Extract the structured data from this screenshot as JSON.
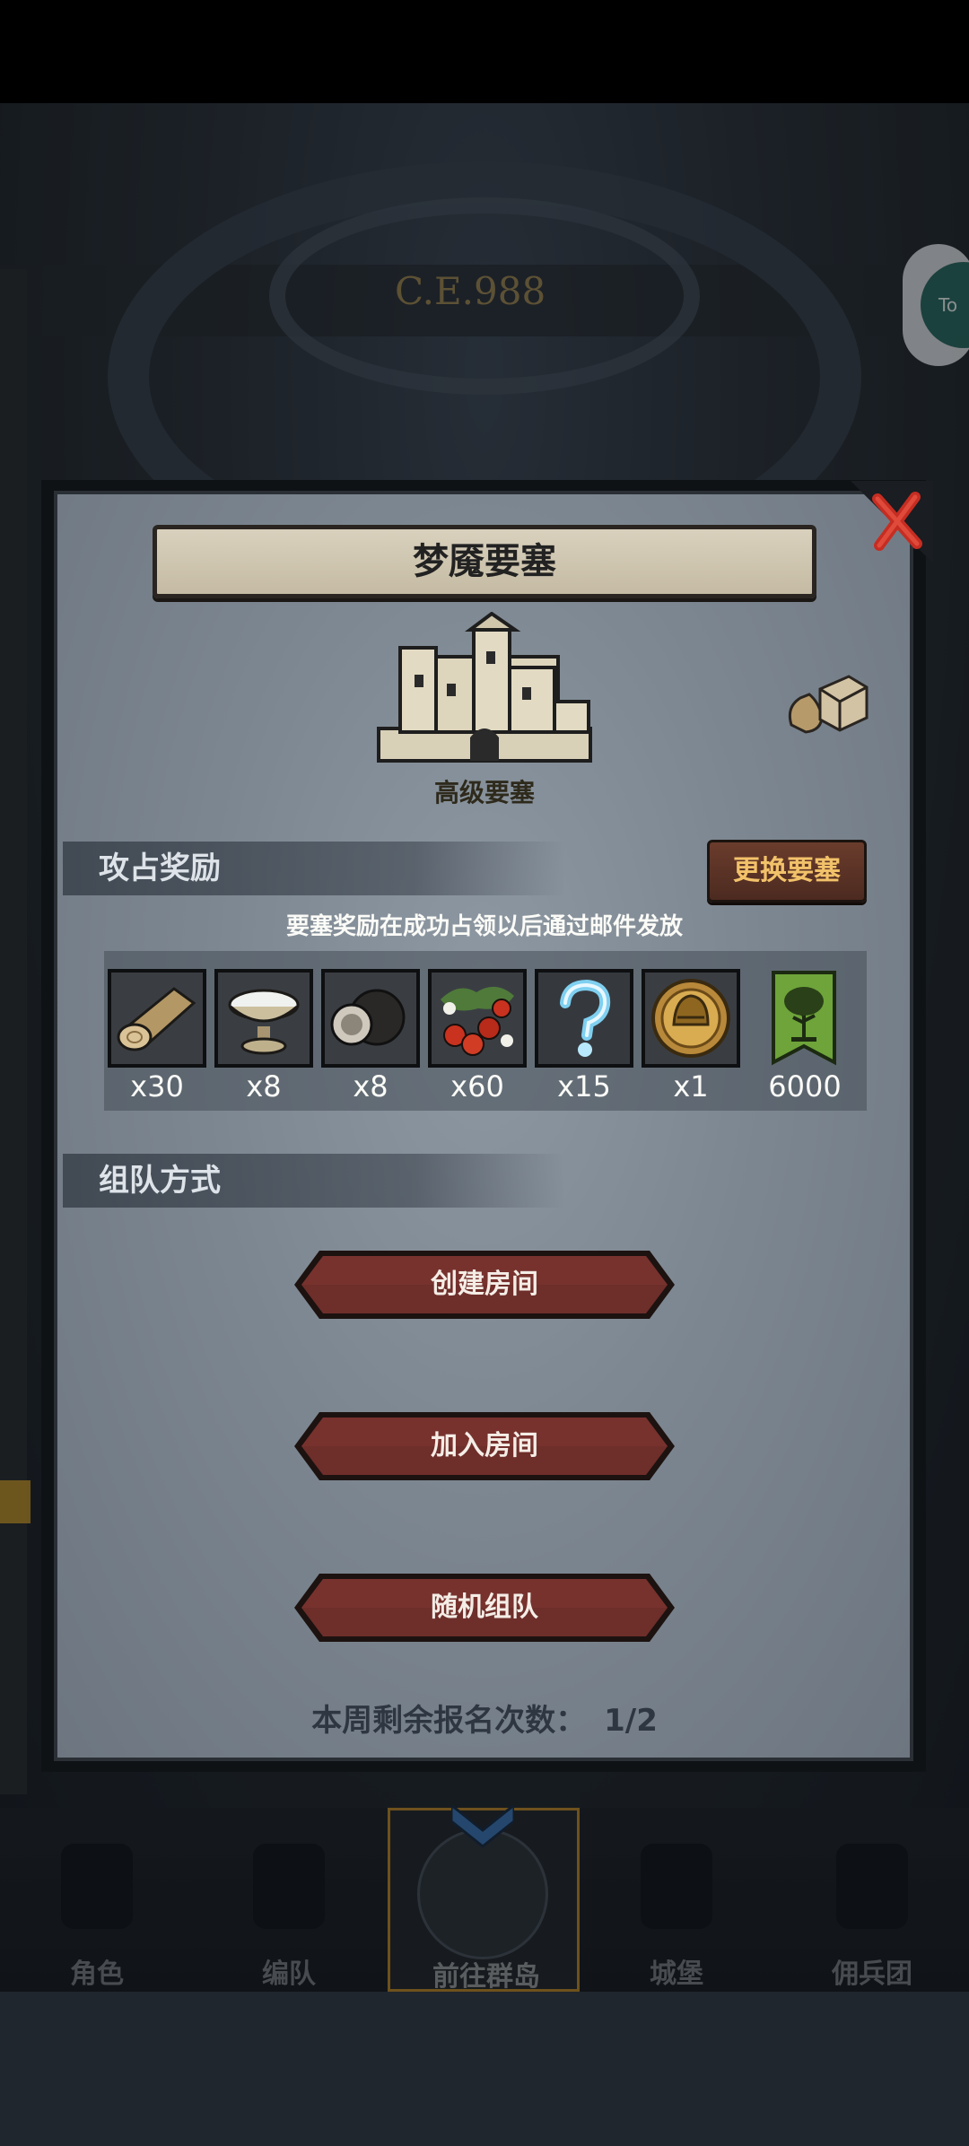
{
  "background": {
    "era_text": "C.E.988",
    "corner_button_text": "To"
  },
  "dialog": {
    "title": "梦魇要塞",
    "fortress_level": "高级要塞",
    "reward_section": {
      "title": "攻占奖励",
      "swap_button": "更换要塞",
      "notice": "要塞奖励在成功占领以后通过邮件发放",
      "items": [
        {
          "icon": "wood-log-icon",
          "count": "x30"
        },
        {
          "icon": "milk-bowl-icon",
          "count": "x8"
        },
        {
          "icon": "truffle-icon",
          "count": "x8"
        },
        {
          "icon": "berries-icon",
          "count": "x60"
        },
        {
          "icon": "mystery-question-icon",
          "count": "x15"
        },
        {
          "icon": "knight-helmet-coin-icon",
          "count": "x1"
        },
        {
          "icon": "tree-banner-icon",
          "count": "6000"
        }
      ]
    },
    "team_section": {
      "title": "组队方式",
      "buttons": [
        "创建房间",
        "加入房间",
        "随机组队"
      ]
    },
    "quota_label": "本周剩余报名次数：",
    "quota_value": "1/2"
  },
  "nav": {
    "items": [
      {
        "label": "角色",
        "icon": "character-icon"
      },
      {
        "label": "编队",
        "icon": "formation-icon"
      },
      {
        "label": "前往群岛",
        "icon": "islands-icon"
      },
      {
        "label": "城堡",
        "icon": "castle-icon"
      },
      {
        "label": "佣兵团",
        "icon": "mercenary-icon"
      }
    ],
    "active": 2
  }
}
